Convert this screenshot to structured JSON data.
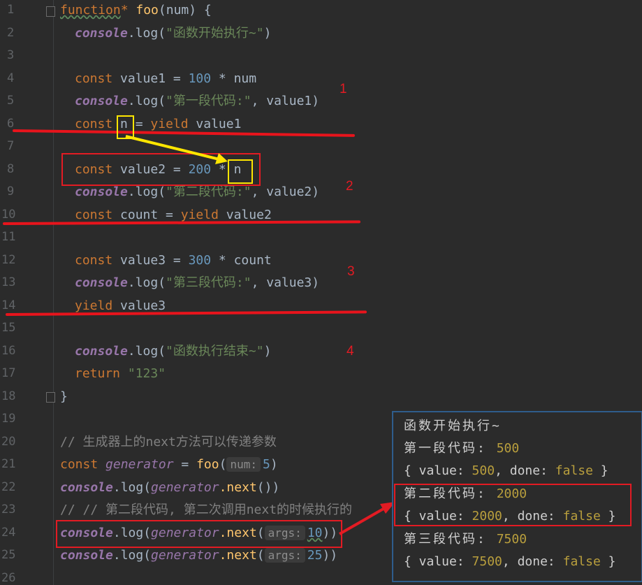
{
  "gutter": {
    "line_numbers": [
      "1",
      "2",
      "3",
      "4",
      "5",
      "6",
      "7",
      "8",
      "9",
      "10",
      "11",
      "12",
      "13",
      "14",
      "15",
      "16",
      "17",
      "18",
      "19",
      "20",
      "21",
      "22",
      "23",
      "24",
      "25",
      "26"
    ]
  },
  "code": {
    "l1_kw": "function",
    "l1_star": "*",
    "l1_name": " foo",
    "l1_rest": "(num) {",
    "console": "console",
    "log": ".log(",
    "l2_str": "\"函数开始执行~\"",
    "close_paren": ")",
    "const": "const",
    "l4_a": " value1 = ",
    "l4_num": "100",
    "l4_b": " * num",
    "l5_str": "\"第一段代码:\"",
    "l5_b": ", value1)",
    "l6_a": " n",
    "l6_b": " = ",
    "yield": "yield",
    "l6_c": " value1",
    "l8_a": " value2 = ",
    "l8_num": "200",
    "l8_b": " * ",
    "l8_n": "n",
    "l9_str": "\"第二段代码:\"",
    "l9_b": ", value2)",
    "l10_a": " count = ",
    "l10_c": " value2",
    "l12_a": " value3 = ",
    "l12_num": "300",
    "l12_b": " * count",
    "l13_str": "\"第三段代码:\"",
    "l13_b": ", value3)",
    "l14_c": " value3",
    "l16_str": "\"函数执行结束~\"",
    "return": "return",
    "l17_str": " \"123\"",
    "l18": "}",
    "l20": "// 生成器上的next方法可以传递参数",
    "l21_kw": "const",
    "l21_var": " generator",
    "l21_eq": " = ",
    "l21_fn": "foo",
    "l21_open": "(",
    "l21_hint": "num:",
    "l21_num": "5",
    "l21_close": ")",
    "generator": "generator",
    "next": ".next",
    "l22_rest": "())",
    "l23": "// // 第二段代码, 第二次调用next的时候执行的",
    "hint_args": "args:",
    "l24_num": "10",
    "l25_num": "25",
    "closes": "))"
  },
  "annotations": {
    "n1": "1",
    "n2": "2",
    "n3": "3",
    "n4": "4"
  },
  "console_output": {
    "line1": "函数开始执行~",
    "line2_label": "第一段代码: ",
    "line2_val": "500",
    "line3_a": "{ value: ",
    "line3_val": "500",
    "line3_b": ", done: ",
    "line3_bool": "false",
    "line3_c": " }",
    "line4_label": "第二段代码: ",
    "line4_val": "2000",
    "line5_a": "{ value: ",
    "line5_val": "2000",
    "line5_b": ", done: ",
    "line5_bool": "false",
    "line5_c": " }",
    "line6_label": "第三段代码: ",
    "line6_val": "7500",
    "line7_a": "{ value: ",
    "line7_val": "7500",
    "line7_b": ", done: ",
    "line7_bool": "false",
    "line7_c": " }"
  },
  "colors": {
    "keyword": "#cc7832",
    "string": "#6a8759",
    "number": "#6897bb",
    "annotation_red": "#e31b23",
    "highlight_yellow": "#ffe600"
  }
}
